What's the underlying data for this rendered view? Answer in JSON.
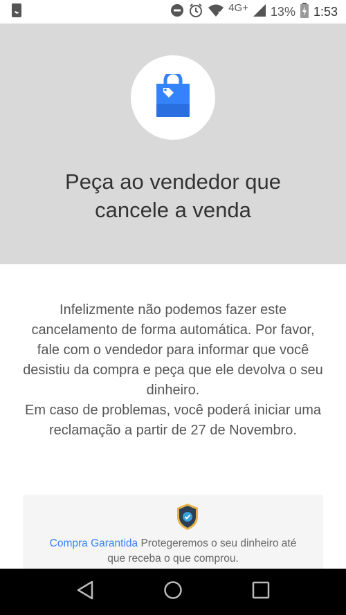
{
  "status_bar": {
    "network": "4G+",
    "battery": "13%",
    "time": "1:53"
  },
  "header": {
    "icon": "shopping-bag-icon",
    "title_line1": "Peça ao vendedor que",
    "title_line2": "cancele a venda"
  },
  "message": {
    "paragraph1": "Infelizmente não podemos fazer este cancelamento de forma automática. Por favor, fale com o vendedor para informar que você desistiu da compra e peça que ele devolva o seu dinheiro.",
    "paragraph2": "Em caso de problemas, você poderá iniciar uma reclamação a partir de 27 de Novembro."
  },
  "guarantee": {
    "icon": "shield-check-icon",
    "link_label": "Compra Garantida",
    "text": " Protegeremos o seu dinheiro até que receba o que comprou."
  },
  "nav": {
    "back": "back-icon",
    "home": "home-icon",
    "recents": "recents-icon"
  },
  "colors": {
    "header_bg": "#d9d9d9",
    "bag_blue": "#3483fa",
    "link_blue": "#3483fa",
    "shield_navy": "#2d3e55",
    "shield_gold": "#e8b24a"
  }
}
